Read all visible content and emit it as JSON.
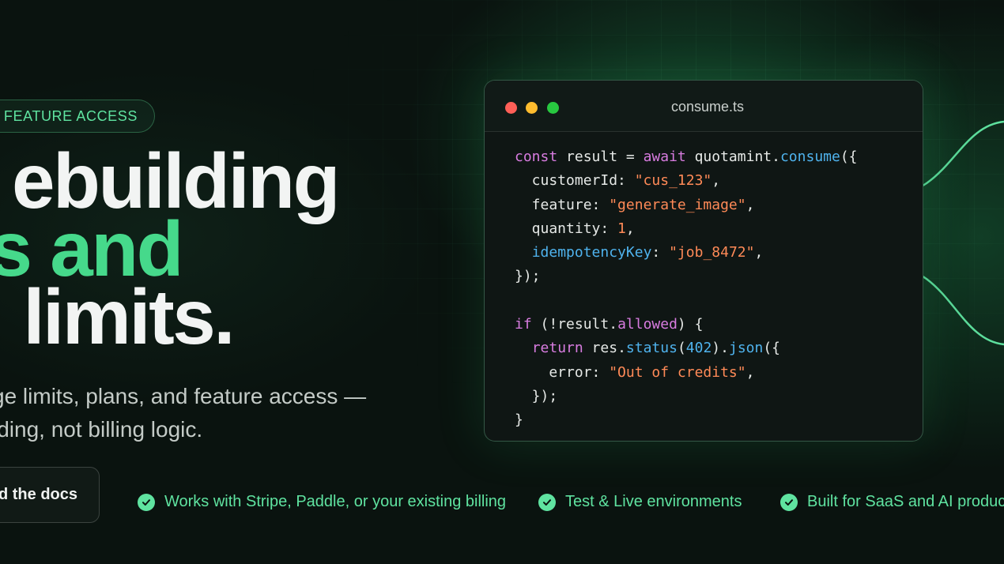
{
  "badge": {
    "label": "FEATURE ACCESS"
  },
  "headline": {
    "line1": "ebuilding",
    "line2": "s and",
    "line3": " limits."
  },
  "subheadline": {
    "line1": "ge limits, plans, and feature access —",
    "line2": "lding, not billing logic."
  },
  "cta": {
    "docs_label": "d the docs"
  },
  "features": [
    {
      "label": "Works with Stripe, Paddle, or your existing billing"
    },
    {
      "label": "Test & Live environments"
    },
    {
      "label": "Built for SaaS and AI produc"
    }
  ],
  "editor": {
    "filename": "consume.ts",
    "code": {
      "l1_kw": "const",
      "l1_a": " result = ",
      "l1_kw2": "await",
      "l1_b": " quotamint.",
      "l1_fn": "consume",
      "l1_c": "({",
      "l2_a": "  customerId: ",
      "l2_str": "\"cus_123\"",
      "l2_b": ",",
      "l3_a": "  feature: ",
      "l3_str": "\"generate_image\"",
      "l3_b": ",",
      "l4_a": "  quantity: ",
      "l4_num": "1",
      "l4_b": ",",
      "l5_a": "  ",
      "l5_fn": "idempotencyKey",
      "l5_b": ": ",
      "l5_str": "\"job_8472\"",
      "l5_c": ",",
      "l6": "});",
      "l8_kw": "if",
      "l8_a": " (!result.",
      "l8_prop": "allowed",
      "l8_b": ") {",
      "l9_a": "  ",
      "l9_kw": "return",
      "l9_b": " res.",
      "l9_fn": "status",
      "l9_c": "(",
      "l9_num": "402",
      "l9_d": ").",
      "l9_fn2": "json",
      "l9_e": "({",
      "l10_a": "    error: ",
      "l10_str": "\"Out of credits\"",
      "l10_b": ",",
      "l11": "  });",
      "l12": "}"
    }
  },
  "colors": {
    "accent": "#46d98b",
    "accent_light": "#5fe3a0",
    "background": "#0a130f",
    "code_keyword": "#d87ce0",
    "code_function": "#4fb3ee",
    "code_string": "#ff8a57"
  },
  "icons": {
    "feature_check": "check-circle-icon"
  }
}
